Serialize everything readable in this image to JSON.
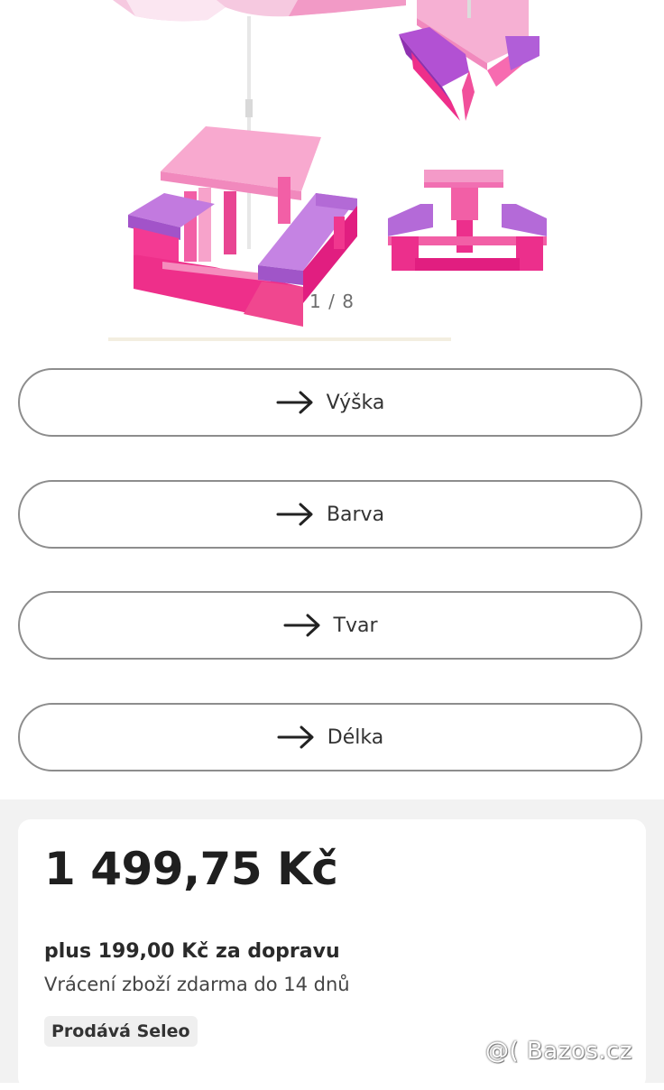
{
  "gallery": {
    "counter": "1 / 8",
    "current_index": 1,
    "total": 8
  },
  "options": [
    {
      "label": "Výška"
    },
    {
      "label": "Barva"
    },
    {
      "label": "Tvar"
    },
    {
      "label": "Délka"
    }
  ],
  "offer": {
    "price": "1 499,75 Kč",
    "shipping": "plus 199,00 Kč za dopravu",
    "returns": "Vrácení zboží zdarma do 14 dnů",
    "seller": "Prodává Seleo"
  },
  "watermark": "@( Bazos.cz",
  "colors": {
    "table_top": "#f49ac8",
    "table_frame": "#ec2f8c",
    "bench": "#b765d8",
    "border": "#8d8d8d",
    "panel_bg": "#f2f2f2"
  }
}
